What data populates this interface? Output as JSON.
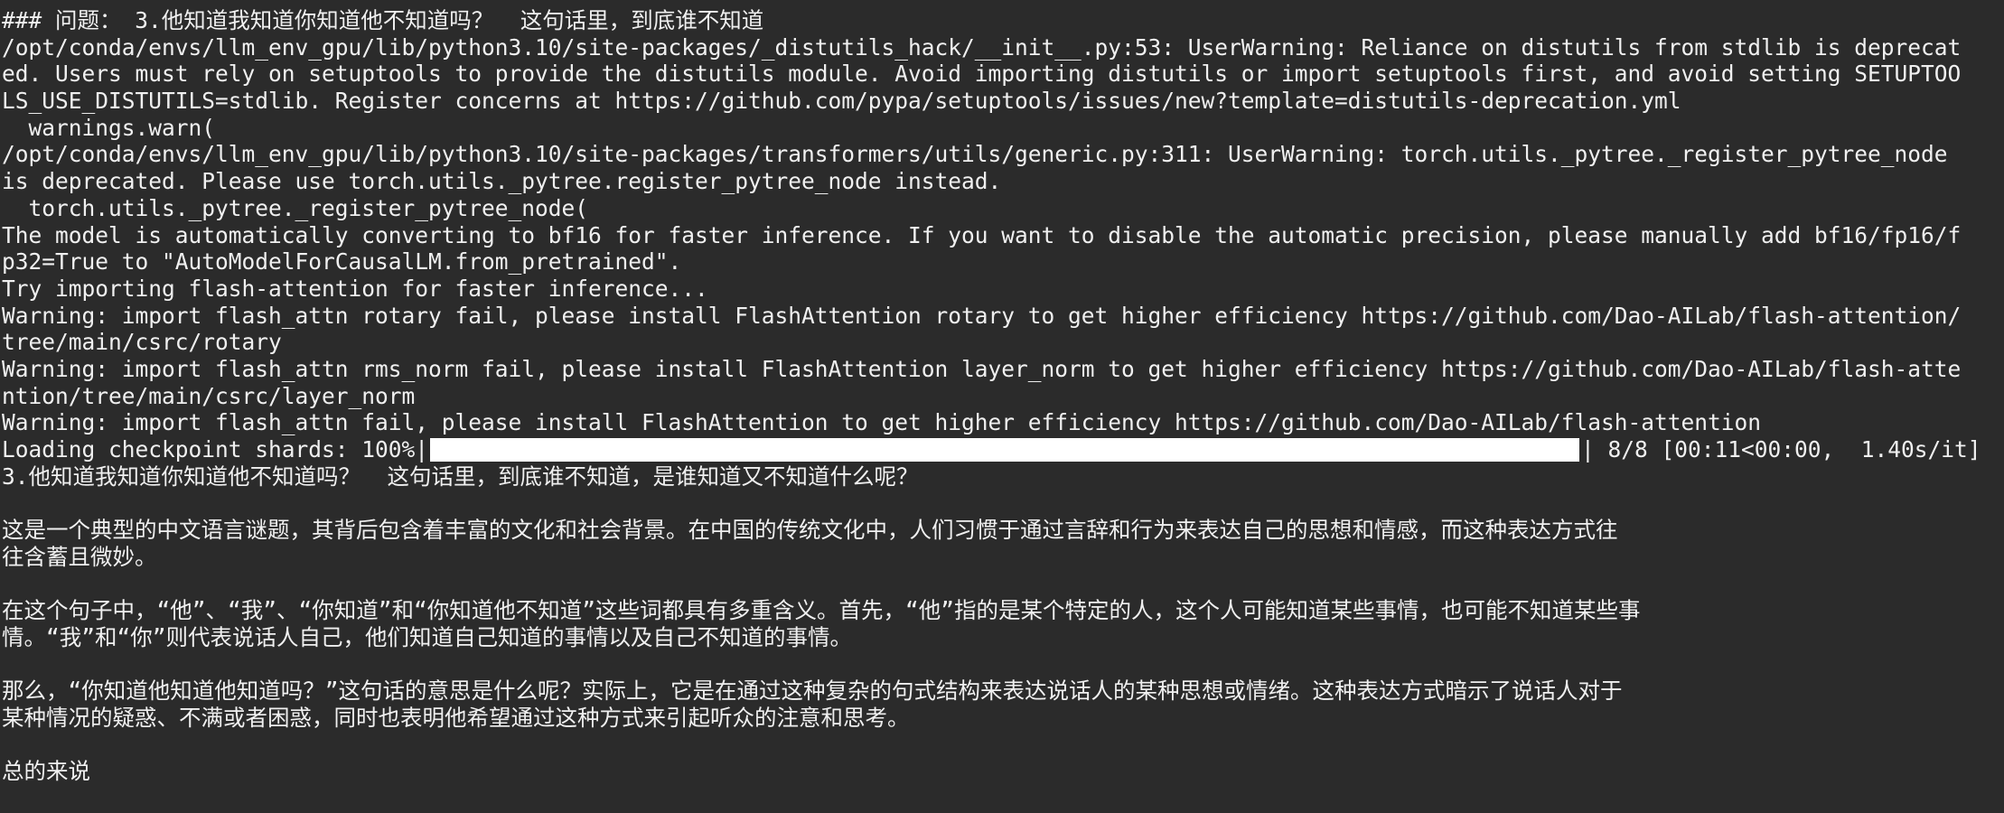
{
  "terminal": {
    "lines_before": [
      "### 问题： 3.他知道我知道你知道他不知道吗？  这句话里，到底谁不知道",
      "/opt/conda/envs/llm_env_gpu/lib/python3.10/site-packages/_distutils_hack/__init__.py:53: UserWarning: Reliance on distutils from stdlib is deprecat",
      "ed. Users must rely on setuptools to provide the distutils module. Avoid importing distutils or import setuptools first, and avoid setting SETUPTOO",
      "LS_USE_DISTUTILS=stdlib. Register concerns at https://github.com/pypa/setuptools/issues/new?template=distutils-deprecation.yml",
      "  warnings.warn(",
      "/opt/conda/envs/llm_env_gpu/lib/python3.10/site-packages/transformers/utils/generic.py:311: UserWarning: torch.utils._pytree._register_pytree_node",
      "is deprecated. Please use torch.utils._pytree.register_pytree_node instead.",
      "  torch.utils._pytree._register_pytree_node(",
      "The model is automatically converting to bf16 for faster inference. If you want to disable the automatic precision, please manually add bf16/fp16/f",
      "p32=True to \"AutoModelForCausalLM.from_pretrained\".",
      "Try importing flash-attention for faster inference...",
      "Warning: import flash_attn rotary fail, please install FlashAttention rotary to get higher efficiency https://github.com/Dao-AILab/flash-attention/",
      "tree/main/csrc/rotary",
      "Warning: import flash_attn rms_norm fail, please install FlashAttention layer_norm to get higher efficiency https://github.com/Dao-AILab/flash-atte",
      "ntion/tree/main/csrc/layer_norm",
      "Warning: import flash_attn fail, please install FlashAttention to get higher efficiency https://github.com/Dao-AILab/flash-attention"
    ],
    "progress": {
      "label": "Loading checkpoint shards: 100%|",
      "fraction": 1.0,
      "suffix": "| 8/8 [00:11<00:00,  1.40s/it]"
    },
    "lines_after": [
      "3.他知道我知道你知道他不知道吗？  这句话里，到底谁不知道，是谁知道又不知道什么呢？",
      "",
      "这是一个典型的中文语言谜题，其背后包含着丰富的文化和社会背景。在中国的传统文化中，人们习惯于通过言辞和行为来表达自己的思想和情感，而这种表达方式往",
      "往含蓄且微妙。",
      "",
      "在这个句子中，“他”、“我”、“你知道”和“你知道他不知道”这些词都具有多重含义。首先，“他”指的是某个特定的人，这个人可能知道某些事情，也可能不知道某些事",
      "情。“我”和“你”则代表说话人自己，他们知道自己知道的事情以及自己不知道的事情。",
      "",
      "那么，“你知道他知道他知道吗？”这句话的意思是什么呢？实际上，它是在通过这种复杂的句式结构来表达说话人的某种思想或情绪。这种表达方式暗示了说话人对于",
      "某种情况的疑惑、不满或者困惑，同时也表明他希望通过这种方式来引起听众的注意和思考。",
      "",
      "总的来说"
    ]
  }
}
